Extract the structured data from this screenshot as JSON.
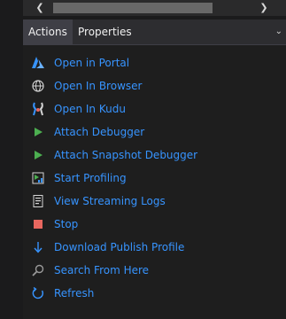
{
  "scrollbar": {
    "left_arrow": "❮",
    "right_arrow": "❯"
  },
  "tabs": [
    {
      "label": "Actions",
      "active": true
    },
    {
      "label": "Properties",
      "active": false
    }
  ],
  "tab_dropdown": "⌄",
  "actions": [
    {
      "label": "Open in Portal",
      "icon": "azure-icon"
    },
    {
      "label": "Open In Browser",
      "icon": "globe-icon"
    },
    {
      "label": "Open In Kudu",
      "icon": "kudu-icon"
    },
    {
      "label": "Attach Debugger",
      "icon": "play-icon"
    },
    {
      "label": "Attach Snapshot Debugger",
      "icon": "play-icon"
    },
    {
      "label": "Start Profiling",
      "icon": "profiler-icon"
    },
    {
      "label": "View Streaming Logs",
      "icon": "log-icon"
    },
    {
      "label": "Stop",
      "icon": "stop-icon"
    },
    {
      "label": "Download Publish Profile",
      "icon": "arrow-down-icon"
    },
    {
      "label": "Search From Here",
      "icon": "search-icon"
    },
    {
      "label": "Refresh",
      "icon": "refresh-icon"
    }
  ],
  "colors": {
    "link": "#3794ff",
    "play": "#4caf50",
    "stop": "#e8675f",
    "azure": "#3794ff"
  }
}
